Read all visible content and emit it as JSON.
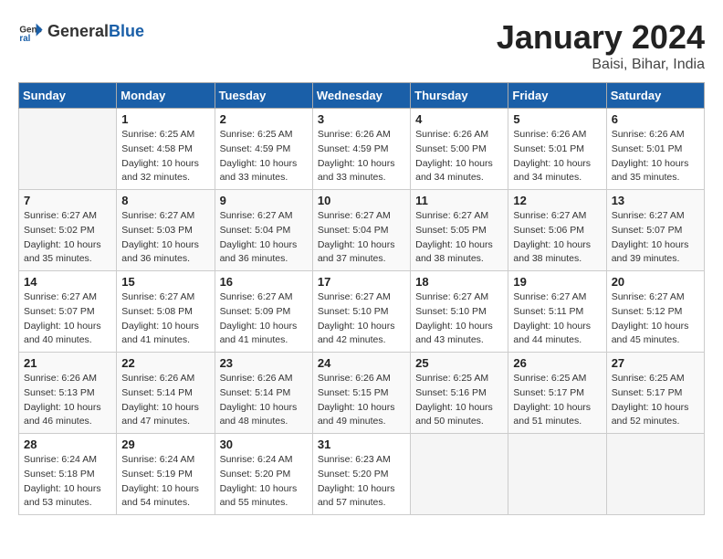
{
  "header": {
    "logo": {
      "general": "General",
      "blue": "Blue"
    },
    "title": "January 2024",
    "subtitle": "Baisi, Bihar, India"
  },
  "calendar": {
    "weekdays": [
      "Sunday",
      "Monday",
      "Tuesday",
      "Wednesday",
      "Thursday",
      "Friday",
      "Saturday"
    ],
    "weeks": [
      [
        {
          "day": "",
          "info": ""
        },
        {
          "day": "1",
          "info": "Sunrise: 6:25 AM\nSunset: 4:58 PM\nDaylight: 10 hours\nand 32 minutes."
        },
        {
          "day": "2",
          "info": "Sunrise: 6:25 AM\nSunset: 4:59 PM\nDaylight: 10 hours\nand 33 minutes."
        },
        {
          "day": "3",
          "info": "Sunrise: 6:26 AM\nSunset: 4:59 PM\nDaylight: 10 hours\nand 33 minutes."
        },
        {
          "day": "4",
          "info": "Sunrise: 6:26 AM\nSunset: 5:00 PM\nDaylight: 10 hours\nand 34 minutes."
        },
        {
          "day": "5",
          "info": "Sunrise: 6:26 AM\nSunset: 5:01 PM\nDaylight: 10 hours\nand 34 minutes."
        },
        {
          "day": "6",
          "info": "Sunrise: 6:26 AM\nSunset: 5:01 PM\nDaylight: 10 hours\nand 35 minutes."
        }
      ],
      [
        {
          "day": "7",
          "info": "Sunrise: 6:27 AM\nSunset: 5:02 PM\nDaylight: 10 hours\nand 35 minutes."
        },
        {
          "day": "8",
          "info": "Sunrise: 6:27 AM\nSunset: 5:03 PM\nDaylight: 10 hours\nand 36 minutes."
        },
        {
          "day": "9",
          "info": "Sunrise: 6:27 AM\nSunset: 5:04 PM\nDaylight: 10 hours\nand 36 minutes."
        },
        {
          "day": "10",
          "info": "Sunrise: 6:27 AM\nSunset: 5:04 PM\nDaylight: 10 hours\nand 37 minutes."
        },
        {
          "day": "11",
          "info": "Sunrise: 6:27 AM\nSunset: 5:05 PM\nDaylight: 10 hours\nand 38 minutes."
        },
        {
          "day": "12",
          "info": "Sunrise: 6:27 AM\nSunset: 5:06 PM\nDaylight: 10 hours\nand 38 minutes."
        },
        {
          "day": "13",
          "info": "Sunrise: 6:27 AM\nSunset: 5:07 PM\nDaylight: 10 hours\nand 39 minutes."
        }
      ],
      [
        {
          "day": "14",
          "info": "Sunrise: 6:27 AM\nSunset: 5:07 PM\nDaylight: 10 hours\nand 40 minutes."
        },
        {
          "day": "15",
          "info": "Sunrise: 6:27 AM\nSunset: 5:08 PM\nDaylight: 10 hours\nand 41 minutes."
        },
        {
          "day": "16",
          "info": "Sunrise: 6:27 AM\nSunset: 5:09 PM\nDaylight: 10 hours\nand 41 minutes."
        },
        {
          "day": "17",
          "info": "Sunrise: 6:27 AM\nSunset: 5:10 PM\nDaylight: 10 hours\nand 42 minutes."
        },
        {
          "day": "18",
          "info": "Sunrise: 6:27 AM\nSunset: 5:10 PM\nDaylight: 10 hours\nand 43 minutes."
        },
        {
          "day": "19",
          "info": "Sunrise: 6:27 AM\nSunset: 5:11 PM\nDaylight: 10 hours\nand 44 minutes."
        },
        {
          "day": "20",
          "info": "Sunrise: 6:27 AM\nSunset: 5:12 PM\nDaylight: 10 hours\nand 45 minutes."
        }
      ],
      [
        {
          "day": "21",
          "info": "Sunrise: 6:26 AM\nSunset: 5:13 PM\nDaylight: 10 hours\nand 46 minutes."
        },
        {
          "day": "22",
          "info": "Sunrise: 6:26 AM\nSunset: 5:14 PM\nDaylight: 10 hours\nand 47 minutes."
        },
        {
          "day": "23",
          "info": "Sunrise: 6:26 AM\nSunset: 5:14 PM\nDaylight: 10 hours\nand 48 minutes."
        },
        {
          "day": "24",
          "info": "Sunrise: 6:26 AM\nSunset: 5:15 PM\nDaylight: 10 hours\nand 49 minutes."
        },
        {
          "day": "25",
          "info": "Sunrise: 6:25 AM\nSunset: 5:16 PM\nDaylight: 10 hours\nand 50 minutes."
        },
        {
          "day": "26",
          "info": "Sunrise: 6:25 AM\nSunset: 5:17 PM\nDaylight: 10 hours\nand 51 minutes."
        },
        {
          "day": "27",
          "info": "Sunrise: 6:25 AM\nSunset: 5:17 PM\nDaylight: 10 hours\nand 52 minutes."
        }
      ],
      [
        {
          "day": "28",
          "info": "Sunrise: 6:24 AM\nSunset: 5:18 PM\nDaylight: 10 hours\nand 53 minutes."
        },
        {
          "day": "29",
          "info": "Sunrise: 6:24 AM\nSunset: 5:19 PM\nDaylight: 10 hours\nand 54 minutes."
        },
        {
          "day": "30",
          "info": "Sunrise: 6:24 AM\nSunset: 5:20 PM\nDaylight: 10 hours\nand 55 minutes."
        },
        {
          "day": "31",
          "info": "Sunrise: 6:23 AM\nSunset: 5:20 PM\nDaylight: 10 hours\nand 57 minutes."
        },
        {
          "day": "",
          "info": ""
        },
        {
          "day": "",
          "info": ""
        },
        {
          "day": "",
          "info": ""
        }
      ]
    ]
  }
}
